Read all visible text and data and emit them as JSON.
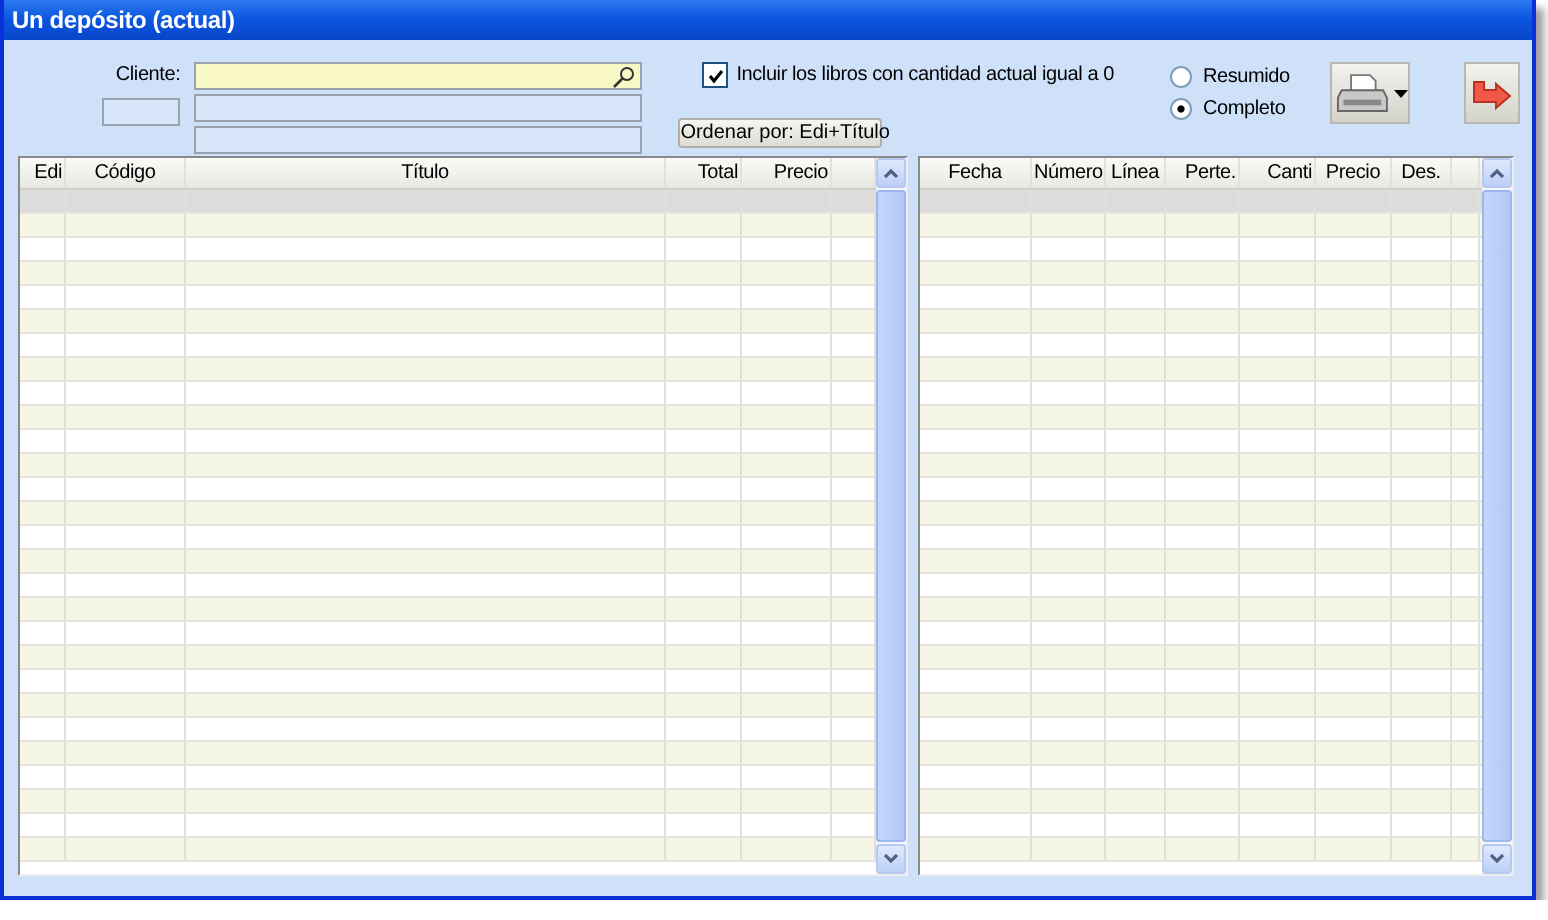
{
  "window": {
    "title": "Un depósito (actual)"
  },
  "client": {
    "label": "Cliente:"
  },
  "include_zero": {
    "label": "Incluir los libros con cantidad actual igual a 0",
    "checked": true
  },
  "sort_button": {
    "label": "Ordenar por: Edi+Título"
  },
  "detail_options": [
    {
      "label": "Resumido",
      "selected": false
    },
    {
      "label": "Completo",
      "selected": true
    }
  ],
  "left_table": {
    "columns": [
      "Edi",
      "Código",
      "Título",
      "Total",
      "Precio"
    ],
    "rows": [
      {
        "selected": true
      },
      {
        "selected": false
      },
      {
        "selected": false
      },
      {
        "selected": false
      },
      {
        "selected": false
      },
      {
        "selected": false
      },
      {
        "selected": false
      },
      {
        "selected": false
      },
      {
        "selected": false
      },
      {
        "selected": false
      },
      {
        "selected": false
      },
      {
        "selected": false
      },
      {
        "selected": false
      },
      {
        "selected": false
      },
      {
        "selected": false
      },
      {
        "selected": false
      },
      {
        "selected": false
      },
      {
        "selected": false
      },
      {
        "selected": false
      },
      {
        "selected": false
      },
      {
        "selected": false
      },
      {
        "selected": false
      },
      {
        "selected": false
      },
      {
        "selected": false
      },
      {
        "selected": false
      },
      {
        "selected": false
      },
      {
        "selected": false
      },
      {
        "selected": false
      }
    ]
  },
  "right_table": {
    "columns": [
      "Fecha",
      "Número",
      "Línea",
      "Perte.",
      "Canti",
      "Precio",
      "Des."
    ],
    "rows": [
      {
        "selected": true
      },
      {
        "selected": false
      },
      {
        "selected": false
      },
      {
        "selected": false
      },
      {
        "selected": false
      },
      {
        "selected": false
      },
      {
        "selected": false
      },
      {
        "selected": false
      },
      {
        "selected": false
      },
      {
        "selected": false
      },
      {
        "selected": false
      },
      {
        "selected": false
      },
      {
        "selected": false
      },
      {
        "selected": false
      },
      {
        "selected": false
      },
      {
        "selected": false
      },
      {
        "selected": false
      },
      {
        "selected": false
      },
      {
        "selected": false
      },
      {
        "selected": false
      },
      {
        "selected": false
      },
      {
        "selected": false
      },
      {
        "selected": false
      },
      {
        "selected": false
      },
      {
        "selected": false
      },
      {
        "selected": false
      },
      {
        "selected": false
      },
      {
        "selected": false
      }
    ]
  }
}
